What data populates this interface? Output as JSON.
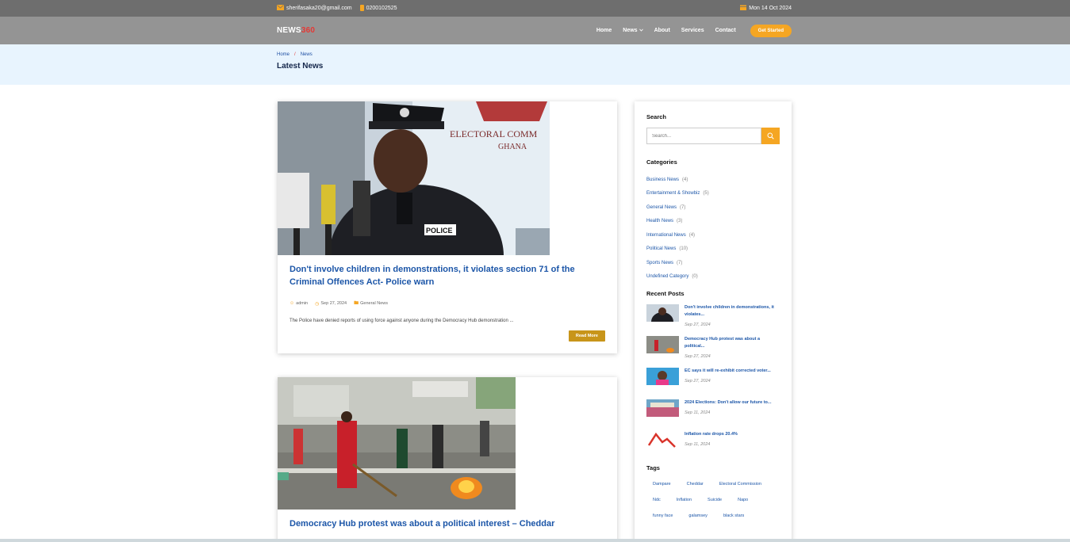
{
  "topbar": {
    "email": "sherifasaka20@gmail.com",
    "phone": "0200102525",
    "date": "Mon 14 Oct 2024"
  },
  "nav": {
    "logo_main": "NEWS",
    "logo_accent": "360",
    "links": [
      "Home",
      "News",
      "About",
      "Services",
      "Contact"
    ],
    "cta": "Get Started"
  },
  "header": {
    "breadcrumb": [
      "Home",
      "News"
    ],
    "title": "Latest News"
  },
  "posts": [
    {
      "title": "Don't involve children in demonstrations, it violates section 71 of the Criminal Offences Act- Police warn",
      "author": "admin",
      "date": "Sep 27, 2024",
      "category": "General News",
      "excerpt": "The Police have denied reports of using force against anyone during the Democracy Hub demonstration ...",
      "read_more": "Read More"
    },
    {
      "title": "Democracy Hub protest was about a political interest – Cheddar"
    }
  ],
  "sidebar": {
    "search_heading": "Search",
    "search_placeholder": "Search...",
    "categories_heading": "Categories",
    "categories": [
      {
        "name": "Business News",
        "count": "(4)"
      },
      {
        "name": "Entertainment & Showbiz",
        "count": "(5)"
      },
      {
        "name": "General News",
        "count": "(7)"
      },
      {
        "name": "Health News",
        "count": "(3)"
      },
      {
        "name": "International News",
        "count": "(4)"
      },
      {
        "name": "Political News",
        "count": "(10)"
      },
      {
        "name": "Sports News",
        "count": "(7)"
      },
      {
        "name": "Undefined Category",
        "count": "(0)"
      }
    ],
    "recent_heading": "Recent Posts",
    "recent": [
      {
        "title": "Don't involve children in demonstrations, it violates...",
        "date": "Sep 27, 2024"
      },
      {
        "title": "Democracy Hub protest was about a political...",
        "date": "Sep 27, 2024"
      },
      {
        "title": "EC says it will re-exhibit corrected voter...",
        "date": "Sep 27, 2024"
      },
      {
        "title": "2024 Elections: Don't allow our future to...",
        "date": "Sep 11, 2024"
      },
      {
        "title": "Inflation rate drops 20.4%",
        "date": "Sep 11, 2024"
      }
    ],
    "tags_heading": "Tags",
    "tags": [
      "Dampare",
      "Cheddar",
      "Electoral Commission",
      "Ndc",
      "Inflation",
      "Suicide",
      "Napo",
      "funny face",
      "galamsey",
      "black stars"
    ]
  },
  "colors": {
    "accent": "#f5a623",
    "link": "#1c56a8",
    "logo_accent": "#e53935"
  }
}
